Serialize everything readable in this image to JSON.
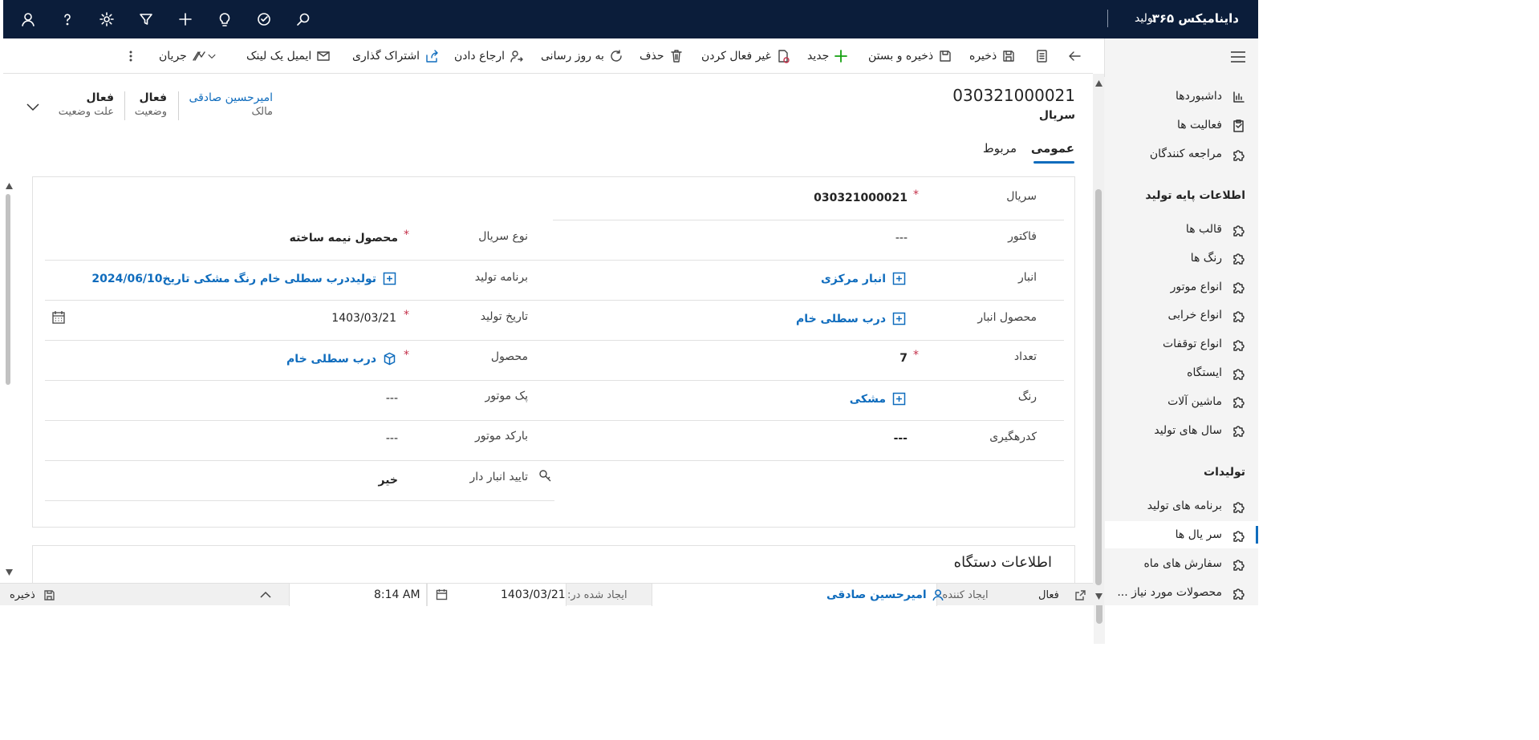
{
  "topbar": {
    "brand": "داینامیکس ۳۶۵",
    "app_name": "تولید"
  },
  "sidebar": {
    "items_top": [
      {
        "label": "داشبوردها",
        "icon": "dashboard-icon"
      },
      {
        "label": "فعالیت ها",
        "icon": "clipboard-icon"
      },
      {
        "label": "مراجعه کنندگان",
        "icon": "puzzle-icon"
      }
    ],
    "group1": "اطلاعات پایه تولید",
    "items_group1": [
      {
        "label": "قالب ها"
      },
      {
        "label": "رنگ ها"
      },
      {
        "label": "انواع موتور"
      },
      {
        "label": "انواع خرابی"
      },
      {
        "label": "انواع توقفات"
      },
      {
        "label": "ایستگاه"
      },
      {
        "label": "ماشین آلات"
      },
      {
        "label": "سال های تولید"
      }
    ],
    "group2": "تولیدات",
    "items_group2": [
      {
        "label": "برنامه های تولید"
      },
      {
        "label": "سر یال ها"
      },
      {
        "label": "سفارش های ماه"
      },
      {
        "label": "محصولات مورد نیاز ..."
      }
    ]
  },
  "commands": {
    "save": "ذخیره",
    "save_close": "ذخیره و بستن",
    "new": "جدید",
    "deactivate": "غیر فعال کردن",
    "delete": "حذف",
    "refresh": "به روز رسانی",
    "assign": "ارجاع دادن",
    "share": "اشتراک گذاری",
    "email_link": "ایمیل یک لینک",
    "flow": "جریان"
  },
  "header": {
    "title": "030321000021",
    "entity": "سریال",
    "owner_value": "امیرحسین صادقی",
    "owner_label": "مالک",
    "status_value": "فعال",
    "status_label": "وضعیت",
    "reason_value": "فعال",
    "reason_label": "علت وضعیت"
  },
  "tabs": {
    "general": "عمومی",
    "related": "مربوط"
  },
  "form": {
    "serial_label": "سریال",
    "serial_value": "030321000021",
    "factor_label": "فاکتور",
    "factor_value": "---",
    "serial_type_label": "نوع سریال",
    "serial_type_value": "محصول نیمه ساخته",
    "warehouse_label": "انبار",
    "warehouse_value": "انبار مرکزی",
    "prod_plan_label": "برنامه تولید",
    "prod_plan_value": "تولیددرب سطلی خام رنگ مشکی تاریخ2024/06/10",
    "wh_product_label": "محصول انبار",
    "wh_product_value": "درب سطلی خام",
    "prod_date_label": "تاریخ تولید",
    "prod_date_value": "1403/03/21",
    "qty_label": "تعداد",
    "qty_value": "7",
    "product_label": "محصول",
    "product_value": "درب سطلی خام",
    "color_label": "رنگ",
    "color_value": "مشکی",
    "engine_pack_label": "پک موتور",
    "engine_pack_value": "---",
    "tracking_label": "کدرهگیری",
    "tracking_value": "---",
    "engine_barcode_label": "بارکد موتور",
    "engine_barcode_value": "---",
    "wh_approval_label": "تایید انبار دار",
    "wh_approval_value": "خیر"
  },
  "section2_title": "اطلاعات دستگاه",
  "statusbar": {
    "state": "فعال",
    "created_by_label": "ایجاد کننده:",
    "created_by_value": "امیرحسین صادقی",
    "created_on_label": "ایجاد شده در:",
    "created_on_date": "1403/03/21",
    "created_on_time": "8:14 AM",
    "save": "ذخیره"
  },
  "colors": {
    "topbar": "#0b1d3a",
    "accent": "#0f6cbd",
    "required": "#c4314b"
  }
}
